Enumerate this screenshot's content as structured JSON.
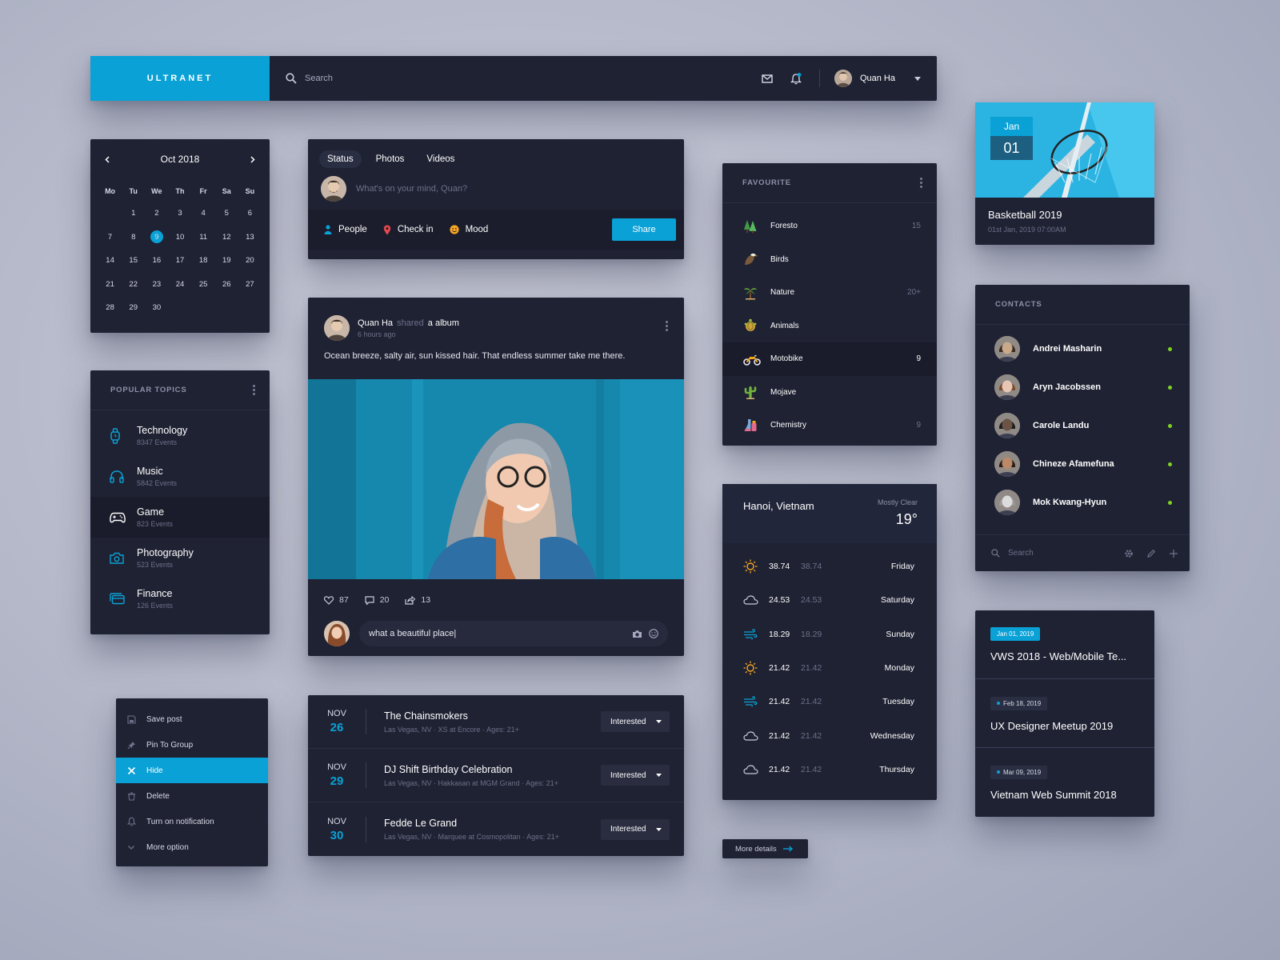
{
  "app": {
    "brand": "ULTRANET",
    "accent_color": "#0aa1d6",
    "online_color": "#7ed321"
  },
  "topbar": {
    "search_placeholder": "Search",
    "user_name": "Quan Ha",
    "icons": [
      "mail-icon",
      "bell-icon",
      "chevron-down-icon"
    ]
  },
  "calendar": {
    "month_label": "Oct 2018",
    "weekdays": [
      "Mo",
      "Tu",
      "We",
      "Th",
      "Fr",
      "Sa",
      "Su"
    ],
    "start_offset": 1,
    "days_in_month": 30,
    "selected_day": 9
  },
  "topics": {
    "title": "POPULAR TOPICS",
    "items": [
      {
        "name": "Technology",
        "events": "8347 Events",
        "icon": "watch-icon"
      },
      {
        "name": "Music",
        "events": "5842 Events",
        "icon": "headphones-icon"
      },
      {
        "name": "Game",
        "events": "823 Events",
        "icon": "gamepad-icon",
        "active": true
      },
      {
        "name": "Photography",
        "events": "523 Events",
        "icon": "camera-icon"
      },
      {
        "name": "Finance",
        "events": "126 Events",
        "icon": "cards-icon"
      }
    ]
  },
  "context_menu": {
    "items": [
      {
        "label": "Save post",
        "icon": "save-icon"
      },
      {
        "label": "Pin To Group",
        "icon": "pin-icon"
      },
      {
        "label": "Hide",
        "icon": "close-icon",
        "active": true
      },
      {
        "label": "Delete",
        "icon": "trash-icon"
      },
      {
        "label": "Turn on notification",
        "icon": "bell-icon"
      },
      {
        "label": "More option",
        "icon": "chevron-down-icon"
      }
    ]
  },
  "composer": {
    "tabs": [
      "Status",
      "Photos",
      "Videos"
    ],
    "placeholder": "What's on your mind, Quan?",
    "options": [
      "People",
      "Check in",
      "Mood"
    ],
    "share_label": "Share"
  },
  "post": {
    "author": "Quan Ha",
    "action": "shared",
    "object": "a album",
    "time": "6 hours ago",
    "text": "Ocean breeze, salty air, sun kissed hair. That endless summer take me there.",
    "likes": "87",
    "comments": "20",
    "shares": "13",
    "comment_value": "what a beautiful place|"
  },
  "events": [
    {
      "month": "NOV",
      "day": "26",
      "title": "The Chainsmokers",
      "subtitle": "Las Vegas, NV · XS at Encore · Ages: 21+",
      "button": "Interested"
    },
    {
      "month": "NOV",
      "day": "29",
      "title": "DJ Shift Birthday Celebration",
      "subtitle": "Las Vegas, NV · Hakkasan at MGM Grand · Ages: 21+",
      "button": "Interested"
    },
    {
      "month": "NOV",
      "day": "30",
      "title": "Fedde Le Grand",
      "subtitle": "Las Vegas, NV · Marquee at Cosmopolitan · Ages: 21+",
      "button": "Interested"
    }
  ],
  "favourite": {
    "title": "FAVOURITE",
    "items": [
      {
        "name": "Foresto",
        "count": "15",
        "icon": "trees-icon",
        "color": "#4caf50"
      },
      {
        "name": "Birds",
        "count": "",
        "icon": "eagle-icon",
        "color": "#e8e0c8"
      },
      {
        "name": "Nature",
        "count": "20+",
        "icon": "palm-icon",
        "color": "#8bc34a"
      },
      {
        "name": "Animals",
        "count": "",
        "icon": "turtle-icon",
        "color": "#c8a43c"
      },
      {
        "name": "Motobike",
        "count": "9",
        "icon": "motorbike-icon",
        "color": "#f5a623",
        "active": true
      },
      {
        "name": "Mojave",
        "count": "",
        "icon": "cactus-icon",
        "color": "#7cb342"
      },
      {
        "name": "Chemistry",
        "count": "9",
        "icon": "flask-icon",
        "color": "#e26a8d"
      }
    ]
  },
  "weather": {
    "city": "Hanoi, Vietnam",
    "condition": "Mostly Clear",
    "temp": "19°",
    "days": [
      {
        "icon": "sun-icon",
        "high": "38.74",
        "low": "38.74",
        "day": "Friday"
      },
      {
        "icon": "cloud-icon",
        "high": "24.53",
        "low": "24.53",
        "day": "Saturday"
      },
      {
        "icon": "wind-icon",
        "high": "18.29",
        "low": "18.29",
        "day": "Sunday"
      },
      {
        "icon": "sun-icon",
        "high": "21.42",
        "low": "21.42",
        "day": "Monday"
      },
      {
        "icon": "wind-icon",
        "high": "21.42",
        "low": "21.42",
        "day": "Tuesday"
      },
      {
        "icon": "cloud-icon",
        "high": "21.42",
        "low": "21.42",
        "day": "Wednesday"
      },
      {
        "icon": "cloud-icon",
        "high": "21.42",
        "low": "21.42",
        "day": "Thursday"
      }
    ],
    "more_label": "More details"
  },
  "basketball": {
    "month": "Jan",
    "day": "01",
    "title": "Basketball 2019",
    "subtitle": "01st Jan, 2019 07:00AM"
  },
  "contacts": {
    "title": "CONTACTS",
    "items": [
      {
        "name": "Andrei Masharin"
      },
      {
        "name": "Aryn Jacobssen"
      },
      {
        "name": "Carole Landu"
      },
      {
        "name": "Chineze Afamefuna"
      },
      {
        "name": "Mok Kwang-Hyun"
      }
    ],
    "search_placeholder": "Search"
  },
  "schedule": [
    {
      "date": "Jan 01, 2019",
      "title": "VWS 2018 - Web/Mobile Te...",
      "highlight": true
    },
    {
      "date": "Feb 18, 2019",
      "title": "UX Designer Meetup 2019",
      "highlight": false
    },
    {
      "date": "Mar 09, 2019",
      "title": "Vietnam Web Summit 2018",
      "highlight": false
    }
  ]
}
